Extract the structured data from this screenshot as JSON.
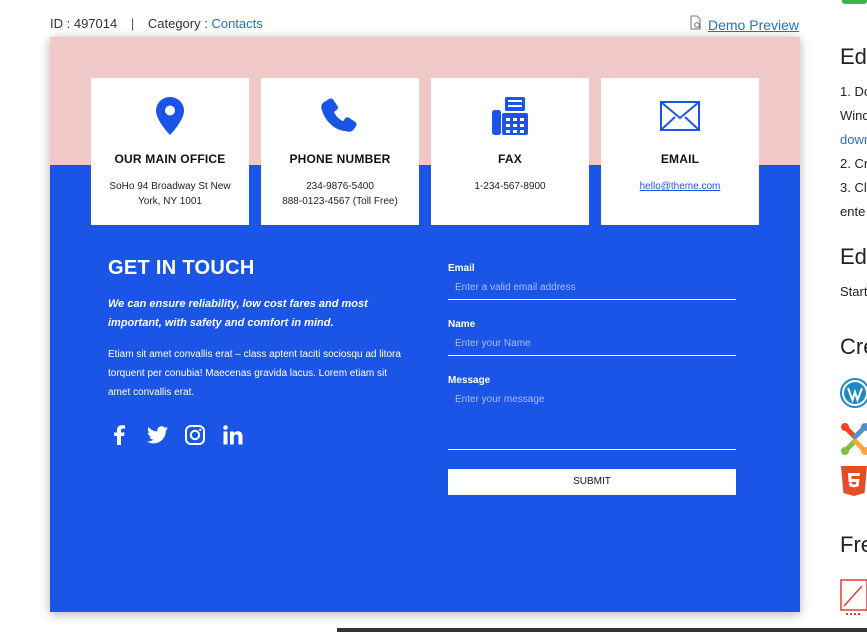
{
  "meta": {
    "id_label": "ID : 497014",
    "separator": "|",
    "category_label": "Category : ",
    "category_value": "Contacts",
    "demo_preview": "Demo Preview"
  },
  "colors": {
    "accent": "#1b55e8",
    "pink": "#f0c8c8",
    "link": "#2a6fbd"
  },
  "cards": [
    {
      "icon": "location-pin-icon",
      "title": "OUR MAIN OFFICE",
      "line1": "SoHo 94 Broadway St New",
      "line2": "York, NY 1001"
    },
    {
      "icon": "phone-icon",
      "title": "PHONE NUMBER",
      "line1": "234-9876-5400",
      "line2": "888-0123-4567 (Toll Free)"
    },
    {
      "icon": "fax-icon",
      "title": "FAX",
      "line1": "1-234-567-8900",
      "line2": ""
    },
    {
      "icon": "envelope-icon",
      "title": "EMAIL",
      "link": "hello@theme.com"
    }
  ],
  "contact": {
    "heading": "GET IN TOUCH",
    "tagline": "We can ensure reliability, low cost fares and most important, with safety and comfort in mind.",
    "body": "Etiam sit amet convallis erat – class aptent taciti sociosqu ad litora torquent per conubia! Maecenas gravida lacus. Lorem etiam sit amet convallis erat."
  },
  "social": [
    "facebook-icon",
    "twitter-icon",
    "instagram-icon",
    "linkedin-icon"
  ],
  "form": {
    "email_label": "Email",
    "email_placeholder": "Enter a valid email address",
    "name_label": "Name",
    "name_placeholder": "Enter your Name",
    "message_label": "Message",
    "message_placeholder": "Enter your message",
    "submit": "SUBMIT"
  },
  "sidebar": {
    "h1": "Ed",
    "l1": "1. Do",
    "l2": "Wind",
    "l3": "down",
    "l4": "2. Cr",
    "l5": "3. Cl",
    "l6": "ente",
    "h2": "Ed",
    "l7": "Start",
    "h3": "Cre",
    "h4": "Fre"
  }
}
